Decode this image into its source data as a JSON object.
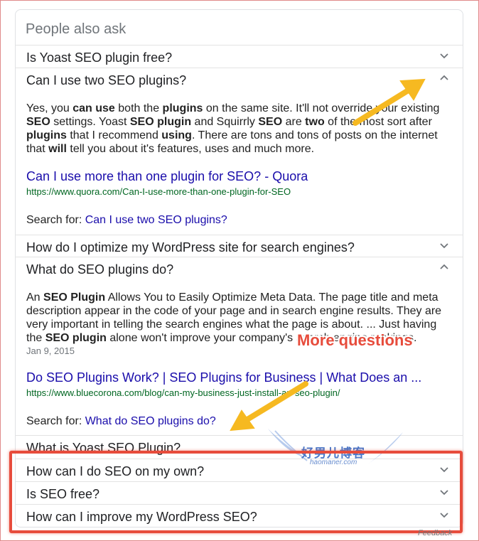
{
  "panel": {
    "heading": "People also ask",
    "feedback": "Feedback"
  },
  "questions": [
    {
      "text": "Is Yoast SEO plugin free?",
      "expanded": false
    },
    {
      "text": "Can I use two SEO plugins?",
      "expanded": true
    },
    {
      "text": "How do I optimize my WordPress site for search engines?",
      "expanded": false
    },
    {
      "text": "What do SEO plugins do?",
      "expanded": true
    },
    {
      "text": "What is Yoast SEO Plugin?",
      "expanded": false
    },
    {
      "text": "How can I do SEO on my own?",
      "expanded": false
    },
    {
      "text": "Is SEO free?",
      "expanded": false
    },
    {
      "text": "How can I improve my WordPress SEO?",
      "expanded": false
    }
  ],
  "answer1": {
    "segments": [
      [
        "Yes, you ",
        false
      ],
      [
        "can use",
        true
      ],
      [
        " both the ",
        false
      ],
      [
        "plugins",
        true
      ],
      [
        " on the same site. It'll not override your existing ",
        false
      ],
      [
        "SEO",
        true
      ],
      [
        " settings. Yoast ",
        false
      ],
      [
        "SEO plugin",
        true
      ],
      [
        " and Squirrly ",
        false
      ],
      [
        "SEO",
        true
      ],
      [
        " are ",
        false
      ],
      [
        "two",
        true
      ],
      [
        " of the most sort after ",
        false
      ],
      [
        "plugins",
        true
      ],
      [
        " that I recommend ",
        false
      ],
      [
        "using",
        true
      ],
      [
        ". There are tons and tons of posts on the internet that ",
        false
      ],
      [
        "will",
        true
      ],
      [
        " tell you about it's features, uses and much more.",
        false
      ]
    ],
    "link_title": "Can I use more than one plugin for SEO? - Quora",
    "link_url": "https://www.quora.com/Can-I-use-more-than-one-plugin-for-SEO",
    "search_for_label": "Search for: ",
    "search_for_query": "Can I use two SEO plugins?"
  },
  "answer2": {
    "segments": [
      [
        "An ",
        false
      ],
      [
        "SEO Plugin",
        true
      ],
      [
        " Allows You to Easily Optimize Meta Data. The page title and meta description appear in the code of your page and in search engine results. They are very important in telling the search engines what the page is about. ... Just having the ",
        false
      ],
      [
        "SEO plugin",
        true
      ],
      [
        " alone won't improve your company's search engine rankings.",
        false
      ]
    ],
    "date": "Jan 9, 2015",
    "link_title": "Do SEO Plugins Work? | SEO Plugins for Business | What Does an ...",
    "link_url": "https://www.bluecorona.com/blog/can-my-business-just-install-an-seo-plugin/",
    "search_for_label": "Search for: ",
    "search_for_query": "What do SEO plugins do?"
  },
  "annotations": {
    "callout": "More questions",
    "arrow_color": "#f6b921",
    "highlight_color": "#e74c3c"
  },
  "watermark": {
    "line1": "好男儿博客",
    "line2": "haomaner.com"
  },
  "colors": {
    "link": "#1a0dab",
    "url": "#006621",
    "muted": "#70757a"
  }
}
